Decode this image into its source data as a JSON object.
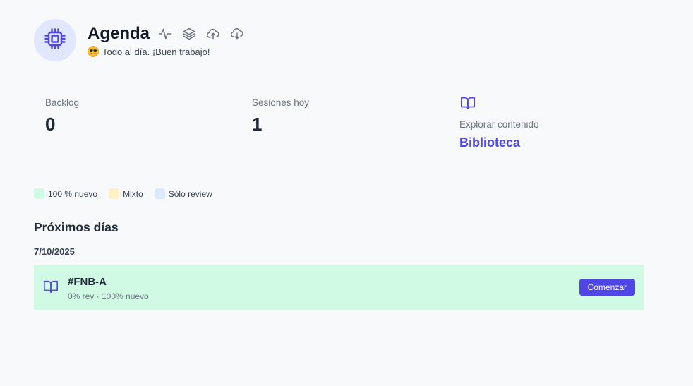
{
  "header": {
    "title": "Agenda",
    "status_text": "Todo al día. ¡Buen trabajo!",
    "status_emoji": "smiling-face-with-sunglasses",
    "app_icon": "cpu-chip-icon",
    "actions": [
      {
        "icon": "activity-icon"
      },
      {
        "icon": "layers-icon"
      },
      {
        "icon": "cloud-upload-icon"
      },
      {
        "icon": "cloud-download-icon"
      }
    ]
  },
  "stats": {
    "backlog": {
      "label": "Backlog",
      "value": "0"
    },
    "sessions_today": {
      "label": "Sesiones hoy",
      "value": "1"
    },
    "explore": {
      "icon": "book-open-icon",
      "label": "Explorar contenido",
      "link": "Biblioteca"
    }
  },
  "legend": [
    {
      "label": "100 % nuevo",
      "color": "#d1fae5"
    },
    {
      "label": "Mixto",
      "color": "#fef3c7"
    },
    {
      "label": "Sólo review",
      "color": "#dbeafe"
    }
  ],
  "upcoming": {
    "title": "Próximos días",
    "days": [
      {
        "date": "7/10/2025",
        "sessions": [
          {
            "icon": "book-open-icon",
            "title": "#FNB-A",
            "subtitle": "0% rev · 100% nuevo",
            "action_label": "Comenzar",
            "color": "#d1fae5"
          }
        ]
      }
    ]
  },
  "colors": {
    "accent": "#4f46e5",
    "background": "#f8f9fb"
  }
}
